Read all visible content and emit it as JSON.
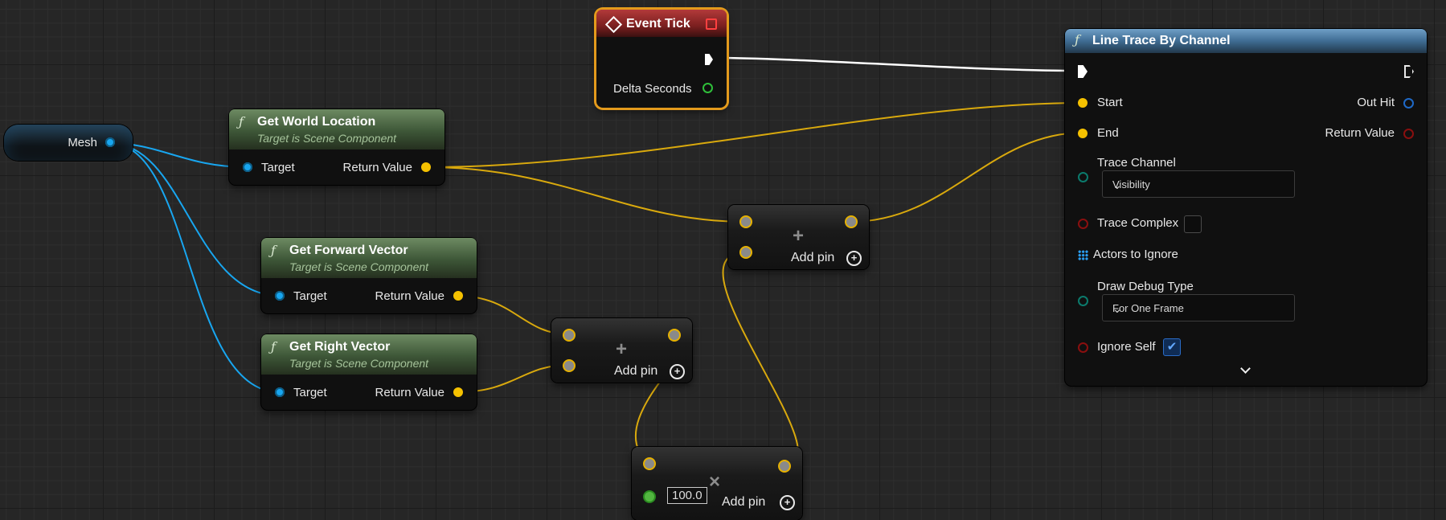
{
  "nodes": {
    "mesh": {
      "label": "Mesh"
    },
    "get_world_location": {
      "title": "Get World Location",
      "subtitle": "Target is Scene Component",
      "input": "Target",
      "output": "Return Value"
    },
    "get_forward_vector": {
      "title": "Get Forward Vector",
      "subtitle": "Target is Scene Component",
      "input": "Target",
      "output": "Return Value"
    },
    "get_right_vector": {
      "title": "Get Right Vector",
      "subtitle": "Target is Scene Component",
      "input": "Target",
      "output": "Return Value"
    },
    "event_tick": {
      "title": "Event Tick",
      "output": "Delta Seconds"
    },
    "add_1": {
      "operator": "+",
      "add_pin": "Add pin"
    },
    "add_2": {
      "operator": "+",
      "add_pin": "Add pin"
    },
    "multiply": {
      "operator": "×",
      "add_pin": "Add pin",
      "value": "100.0"
    },
    "line_trace": {
      "title": "Line Trace By Channel",
      "start": "Start",
      "end": "End",
      "out_hit": "Out Hit",
      "return_value": "Return Value",
      "trace_channel_label": "Trace Channel",
      "trace_channel_value": "Visibility",
      "trace_complex": "Trace Complex",
      "trace_complex_checked": false,
      "actors_to_ignore": "Actors to Ignore",
      "draw_debug_type_label": "Draw Debug Type",
      "draw_debug_type_value": "For One Frame",
      "ignore_self": "Ignore Self",
      "ignore_self_checked": true
    }
  },
  "colors": {
    "object_pin": "#18a6f0",
    "vector_pin": "#f5c100",
    "exec_wire": "#ffffff",
    "event_border": "#e39a1c",
    "function_header": "#4a6a42",
    "trace_header": "#4f7ea6"
  },
  "icons": {
    "function": "function-icon",
    "event": "event-diamond-icon",
    "add_pin": "plus-circle-icon",
    "expand": "chevron-down-icon",
    "array": "array-grid-icon"
  }
}
